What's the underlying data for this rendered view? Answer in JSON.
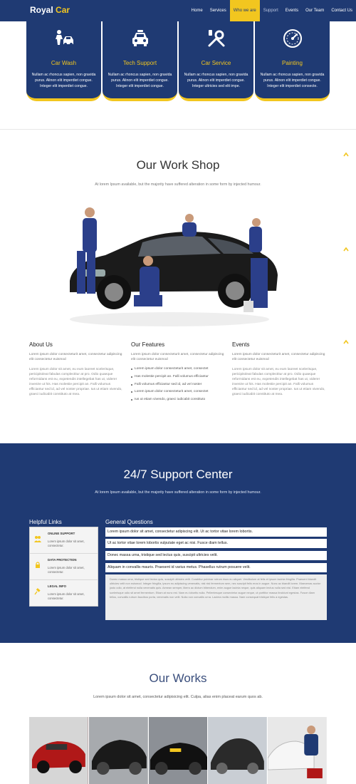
{
  "brand": {
    "name": "Royal",
    "accent_word": "Car"
  },
  "nav": {
    "items": [
      {
        "label": "Home"
      },
      {
        "label": "Services"
      },
      {
        "label": "Who we are",
        "active": true
      },
      {
        "label": "Support"
      },
      {
        "label": "Events"
      },
      {
        "label": "Our Team"
      },
      {
        "label": "Contact Us"
      }
    ]
  },
  "services": [
    {
      "title": "Car Wash",
      "icon": "car-wash-icon",
      "text": "Nullam ac rhoncus sapien, non gravida purus. Alinon elit imperdiet congue. Integer elit imperdiet congue."
    },
    {
      "title": "Tech Support",
      "icon": "car-front-icon",
      "text": "Nullam ac rhoncus sapien, non gravida purus. Alinon elit imperdiet congue. Integer elit imperdiet congue."
    },
    {
      "title": "Car Service",
      "icon": "wrench-icon",
      "text": "Nullam ac rhoncus sapien, non gravida purus. Alinon elit imperdiet congue. Integer ultricies sed elit impe."
    },
    {
      "title": "Painting",
      "icon": "speedometer-icon",
      "text": "Nullam ac rhoncus sapien, non gravida purus. Alinon elit imperdiet congue. Integer elit imperdiet consecte."
    }
  ],
  "workshop": {
    "title": "Our Work Shop",
    "subtitle": "At lorem Ipsum available, but the majority have suffered alteration in some form by injected humour.",
    "columns": [
      {
        "heading": "About Us",
        "lead": "Lorem ipsum dolor consecteturit amet, consectetur adipiscing elit consectetur euismod",
        "body": "Lorem ipsum dolor sit amet, eu eum laoreet scelerisque, pericipitoleat fabulas complectitur at pro. Odio quaeque reformidans est eu, expetendis intellegebat has ut, viderer invenire ut his. Has molestie percipit an. Falli volumus efficiantur sed id, ad vel noster propriae. Ius ut etiam vivendo, graeci iudicabit constituto at mea."
      },
      {
        "heading": "Our Features",
        "lead": "Lorem ipsum dolor consecteturit amet, consectetur adipiscing elit consectetur euismod",
        "bullets": [
          "Lorem ipsum dolor consecteturit amet, consectet",
          "Has molestie percipit an. Falli volumus efficiantur",
          "Falli volumus efficiantur sed id, ad vel noster",
          "Lorem ipsum dolor consecteturit amet, consectet",
          "Ius ut etiam vivendo, graeci iudicabit constituto"
        ]
      },
      {
        "heading": "Events",
        "lead": "Lorem ipsum dolor consecteturit amet, consectetur adipiscing elit consectetur euismod",
        "body": "Lorem ipsum dolor sit amet, eu eum laoreet scelerisque, pericipitoleat fabulas complectitur at pro. Odio quaeque reformidans est eu, expetendis intellegebat has ut, viderer invenire ut his. Has molestie percipit an. Falli volumus efficiantur sed id, ad vel noster propriae. Ius ut etiam vivendo, graeci iudicabit constituto at mea."
      }
    ]
  },
  "support": {
    "title": "24/7 Support Center",
    "subtitle": "At lorem Ipsum available, but the majority have suffered alteration in some form by injected humour.",
    "links_title": "Helpful Links",
    "links": [
      {
        "title": "ONLINE SUPPORT",
        "icon": "people-icon",
        "text": "Lorem ipsum dolor sit amet, consectetur."
      },
      {
        "title": "DATA PROTECTION",
        "icon": "lock-icon",
        "text": "Lorem ipsum dolor sit amet, consectetur."
      },
      {
        "title": "LEGAL INFO",
        "icon": "gavel-icon",
        "text": "Lorem ipsum dolor sit amet, consectetur."
      }
    ],
    "questions_title": "General Questions",
    "questions": [
      "Lorem ipsum dolor sit amet, consectetur adipiscing elit. Ut ac tortor vitae lorem lobortis.",
      "Ut ac tortor vitae lorem lobortis vulputate eget ac nisi. Fusce diam tellus.",
      "Donec massa urna, tristique sed lectus quis, suscipit ultricies velit.",
      "Aliquam in convallis mauris. Praesent id varius metus. Phasellus rutrum posuere velit."
    ],
    "answer": "Donec massa urna, tristique sed lectus quis, suscipit ultricies velit. Curabitur pulvinar rutrum risus eu aliquet. Vestibulum at felis et ipsum lacinia fringilla. Praesent blandit ultricies velit non euismod. Integer fringilla, ipsum eu adipiscing venenatis, nisl nisl fermentum sem, nec suscipit felis eros in augue. Nunc ac blandit lorem. Maecenas auctor justo odio, at eleifend nulla venenatis quis. Aenean semper, libero ac dictum bibendum, enim augue lacinia neque, quis aliquam lectus nulla sed nisl. Etiam eleifend scelerisque odio sit amet fermentum. Etiam at nunc est. Nam eu lobortis nulla. Pellentesque consectetur augue neque, ut porttitor massa tincidunt egestas. Fusce diam tellus, convallis rutrum faucibus porta, venenatis non velit. Nulla non convallis urna. Lacinia mollis massa. Nam consequat tristique felis a egestas."
  },
  "works": {
    "title": "Our Works",
    "subtitle": "Lorem ipsum dolor sit amet, consectetur adipisicing elit. Culpa, alias enim placeat earum quos ab."
  },
  "colors": {
    "primary": "#1f3a73",
    "accent": "#f2c61f"
  }
}
